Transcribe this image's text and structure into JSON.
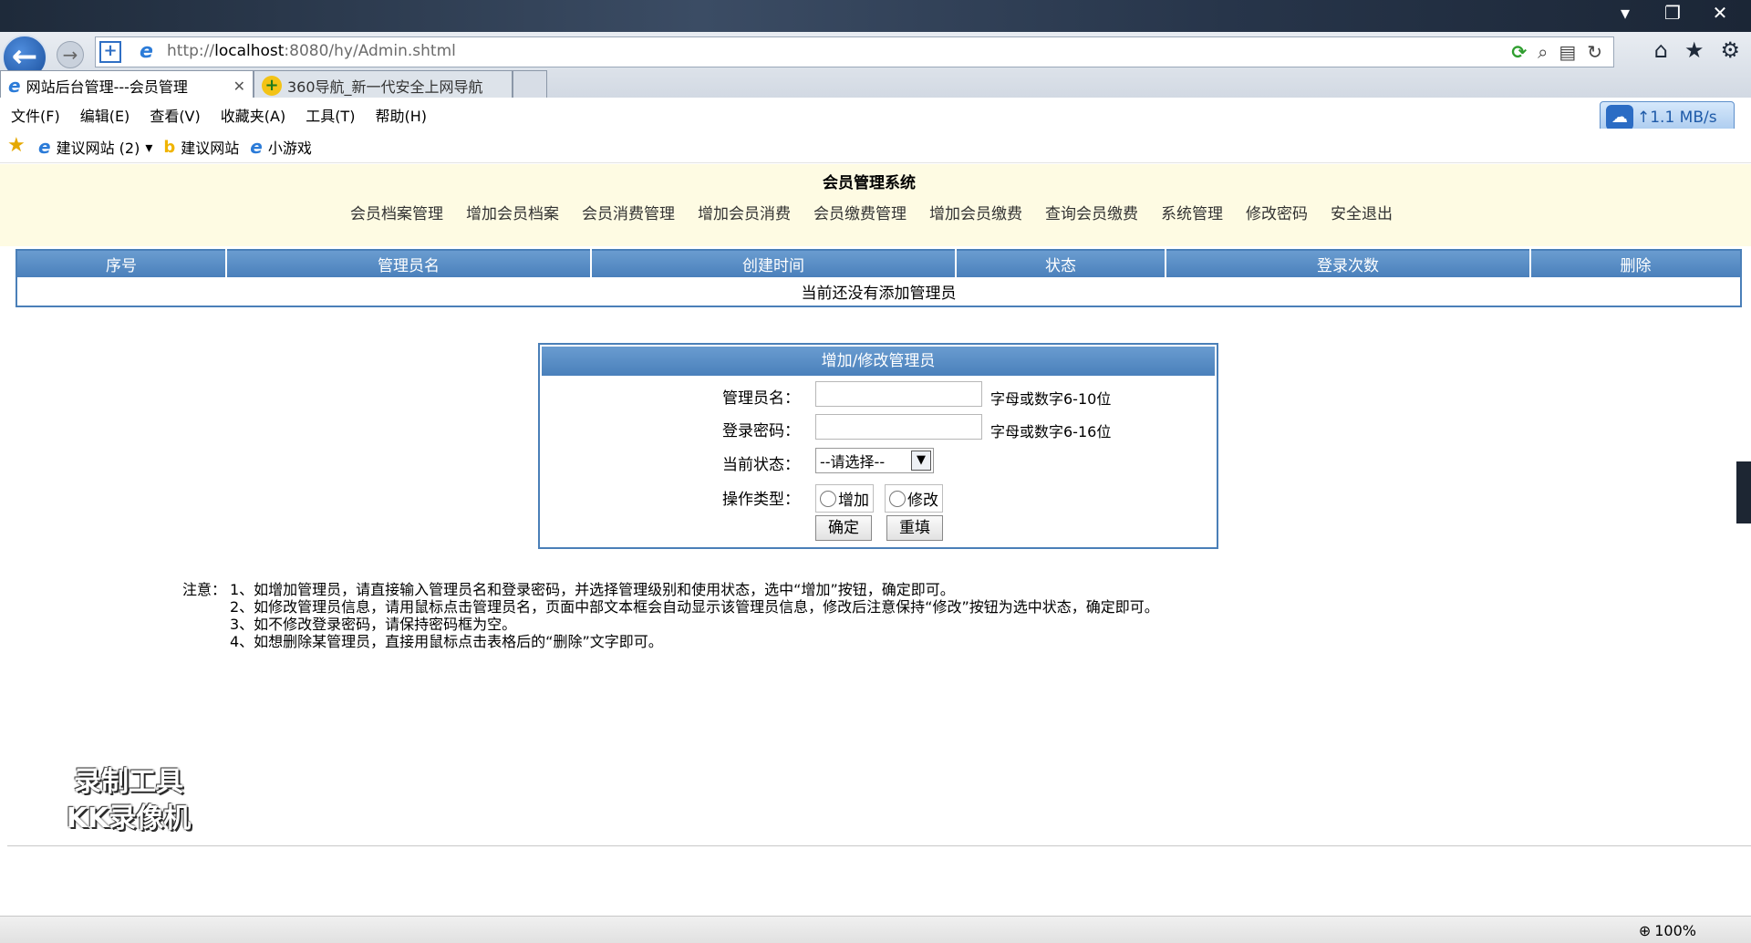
{
  "browser": {
    "window_controls": {
      "minimize": "▾",
      "restore": "❐",
      "close": "✕"
    },
    "address": {
      "prefix": "http://",
      "host": "localhost",
      "rest": ":8080/hy/Admin.shtml"
    },
    "tabs": [
      {
        "label": "网站后台管理---会员管理",
        "close": "✕"
      },
      {
        "label": "360导航_新一代安全上网导航"
      }
    ],
    "menu": [
      "文件(F)",
      "编辑(E)",
      "查看(V)",
      "收藏夹(A)",
      "工具(T)",
      "帮助(H)"
    ],
    "speed": "↑1.1 MB/s",
    "favorites": [
      {
        "label": "建议网站 (2)",
        "icon": "ie-page-icon"
      },
      {
        "label": "建议网站",
        "icon": "bing-icon"
      },
      {
        "label": "小游戏",
        "icon": "ie-page-icon"
      }
    ],
    "zoom": "100%"
  },
  "page": {
    "title": "会员管理系统",
    "nav": [
      "会员档案管理",
      "增加会员档案",
      "会员消费管理",
      "增加会员消费",
      "会员缴费管理",
      "增加会员缴费",
      "查询会员缴费",
      "系统管理",
      "修改密码",
      "安全退出"
    ],
    "table": {
      "columns": [
        "序号",
        "管理员名",
        "创建时间",
        "状态",
        "登录次数",
        "删除"
      ],
      "empty_message": "当前还没有添加管理员"
    },
    "form": {
      "title": "增加/修改管理员",
      "name_label": "管理员名：",
      "name_hint": "字母或数字6-10位",
      "name_value": "",
      "pwd_label": "登录密码：",
      "pwd_hint": "字母或数字6-16位",
      "pwd_value": "",
      "state_label": "当前状态：",
      "state_selected": "--请选择--",
      "type_label": "操作类型：",
      "type_add": "增加",
      "type_edit": "修改",
      "ok_button": "确定",
      "reset_button": "重填"
    },
    "notes": {
      "lead": "注意：",
      "items": [
        "1、如增加管理员，请直接输入管理员名和登录密码，并选择管理级别和使用状态，选中“增加”按钮，确定即可。",
        "2、如修改管理员信息，请用鼠标点击管理员名，页面中部文本框会自动显示该管理员信息，修改后注意保持“修改”按钮为选中状态，确定即可。",
        "3、如不修改登录密码，请保持密码框为空。",
        "4、如想删除某管理员，直接用鼠标点击表格后的“删除”文字即可。"
      ]
    },
    "watermark": [
      "录制工具",
      "KK录像机"
    ]
  }
}
